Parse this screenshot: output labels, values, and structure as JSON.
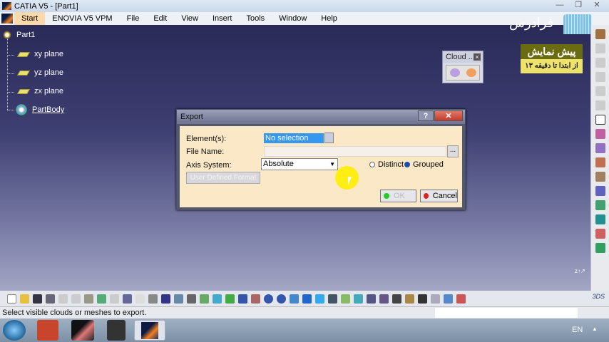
{
  "window": {
    "title": "CATIA V5 - [Part1]",
    "minimize": "—",
    "maximize": "❐",
    "close": "✕"
  },
  "menu": [
    "Start",
    "ENOVIA V5 VPM",
    "File",
    "Edit",
    "View",
    "Insert",
    "Tools",
    "Window",
    "Help"
  ],
  "tree": {
    "root": "Part1",
    "items": [
      "xy plane",
      "yz plane",
      "zx plane"
    ],
    "body": "PartBody"
  },
  "cloud_toolbar": {
    "title": "Cloud ...",
    "close": "×"
  },
  "watermark": {
    "brand": "فرادرس",
    "promo_title": "پیش نمایش",
    "promo_sub": "از ابتدا تا دقیقه ۱۳"
  },
  "dialog": {
    "title": "Export",
    "help": "?",
    "close": "✕",
    "elements_label": "Element(s):",
    "elements_value": "No selection",
    "filename_label": "File Name:",
    "filename_value": "",
    "browse": "...",
    "axis_label": "Axis System:",
    "axis_value": "Absolute",
    "radio_distinct": "Distinct",
    "radio_grouped": "Grouped",
    "selected_mode": "Grouped",
    "udf_button": "User Defined Format",
    "ok": "OK",
    "cancel": "Cancel"
  },
  "status": {
    "message": "Select visible clouds or meshes to export."
  },
  "taskbar": {
    "lang": "EN",
    "tray_arrow": "▲"
  },
  "colors": {
    "canvas_top": "#2a2a58",
    "dialog_bg": "#fbe8c6",
    "selection": "#3598ee"
  }
}
